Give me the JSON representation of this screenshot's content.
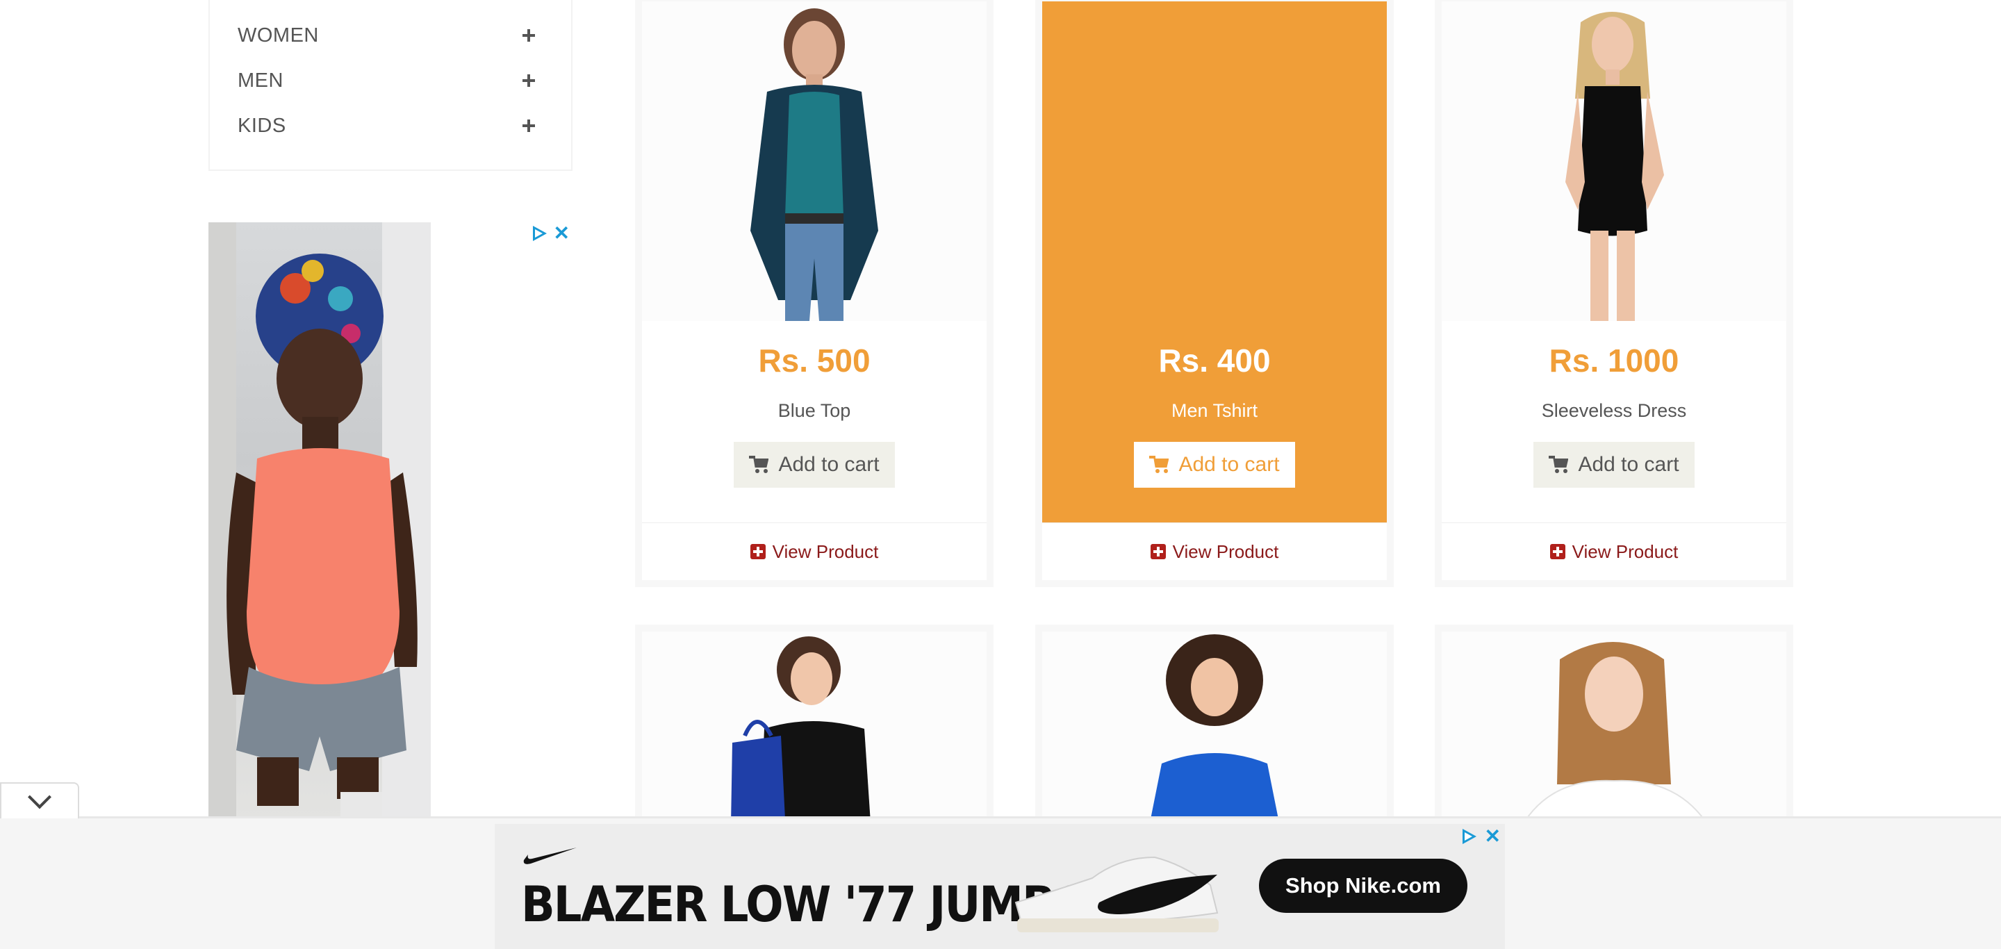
{
  "categories": {
    "items": [
      {
        "label": "WOMEN"
      },
      {
        "label": "MEN"
      },
      {
        "label": "KIDS"
      }
    ]
  },
  "products": [
    {
      "price": "Rs. 500",
      "name": "Blue Top",
      "add_label": "Add to cart",
      "view_label": "View Product"
    },
    {
      "price": "Rs. 400",
      "name": "Men Tshirt",
      "add_label": "Add to cart",
      "view_label": "View Product"
    },
    {
      "price": "Rs. 1000",
      "name": "Sleeveless Dress",
      "add_label": "Add to cart",
      "view_label": "View Product"
    }
  ],
  "bottom_ad": {
    "headline": "BLAZER LOW '77 JUMBO",
    "cta": "Shop Nike.com"
  },
  "colors": {
    "accent": "#f09e38",
    "link": "#8b1a1a",
    "ad_icon": "#1a9ad6"
  },
  "icons": [
    "plus-icon",
    "cart-icon",
    "view-product-icon",
    "ad-choices-icon",
    "close-icon",
    "chevron-down-icon",
    "nike-swoosh-icon"
  ]
}
